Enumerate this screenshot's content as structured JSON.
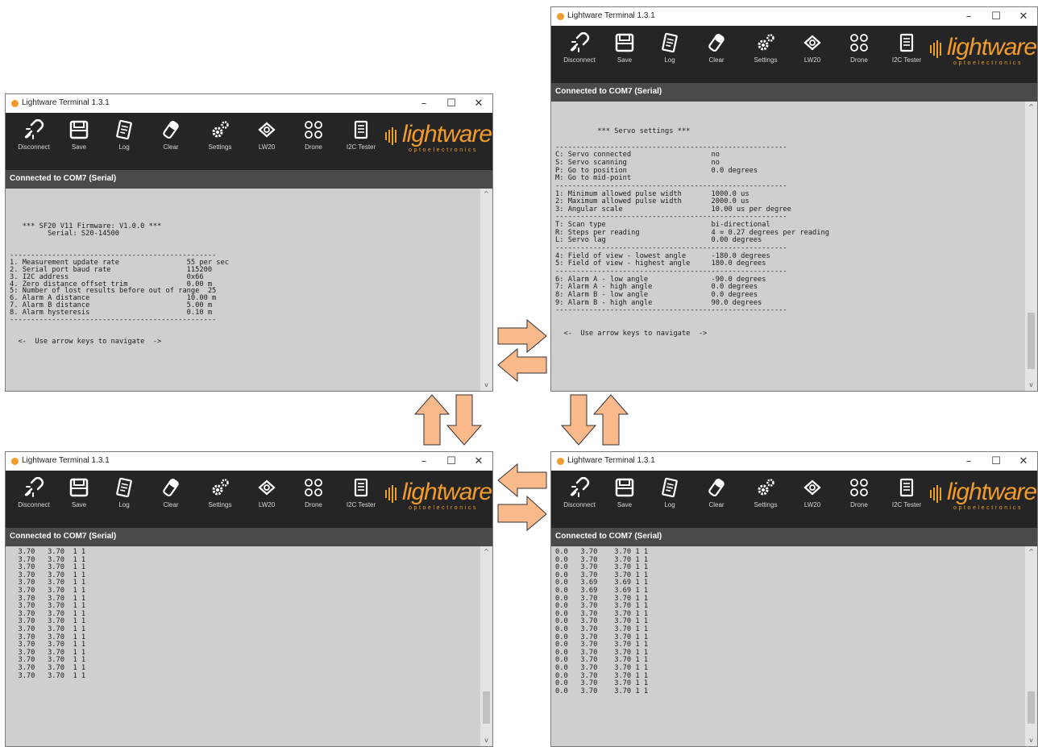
{
  "app_title": "Lightware Terminal 1.3.1",
  "window_controls": {
    "minimize": "–",
    "maximize": "☐",
    "close": "✕"
  },
  "toolbar": [
    {
      "label": "Disconnect",
      "icon": "broken-link-icon"
    },
    {
      "label": "Save",
      "icon": "floppy-disk-icon"
    },
    {
      "label": "Log",
      "icon": "notepad-icon"
    },
    {
      "label": "Clear",
      "icon": "eraser-icon"
    },
    {
      "label": "Settings",
      "icon": "gears-icon"
    },
    {
      "label": "LW20",
      "icon": "sensor-icon"
    },
    {
      "label": "Drone",
      "icon": "drone-icon"
    },
    {
      "label": "I2C Tester",
      "icon": "document-icon"
    }
  ],
  "logo": {
    "word": "lightware",
    "tagline": "optoelectronics"
  },
  "status": "Connected to COM7 (Serial)",
  "scroll": {
    "up": "^",
    "down": "v"
  },
  "colors": {
    "accent": "#f29b2c",
    "toolbar_bg": "#252525",
    "status_bg": "#4a4a4a",
    "terminal_bg": "#cfcfcf",
    "arrow_fill": "#f9b98a"
  },
  "windows": [
    {
      "id": "main-settings",
      "lines": [
        "",
        "",
        "   *** SF20 V11 Firmware: V1.0.0 ***",
        "         Serial: S20-14500",
        "",
        "",
        "-------------------------------------------------",
        "1. Measurement update rate                55 per sec",
        "2. Serial port baud rate                  115200",
        "3. I2C address                            0x66",
        "4. Zero distance offset trim              0.00 m",
        "5: Number of lost results before out of range  25",
        "6. Alarm A distance                       10.00 m",
        "7. Alarm B distance                       5.00 m",
        "8. Alarm hysteresis                       0.10 m",
        "-------------------------------------------------",
        "",
        "",
        "  <-  Use arrow keys to navigate  ->"
      ]
    },
    {
      "id": "servo-settings",
      "lines": [
        "",
        "",
        "          *** Servo settings ***",
        "",
        "-------------------------------------------------------",
        "C: Servo connected                   no",
        "S: Servo scanning                    no",
        "P: Go to position                    0.0 degrees",
        "M: Go to mid-point",
        "-------------------------------------------------------",
        "1: Minimum allowed pulse width       1000.0 us",
        "2: Maximum allowed pulse width       2000.0 us",
        "3: Angular scale                     10.00 us per degree",
        "-------------------------------------------------------",
        "T: Scan type                         bi-directional",
        "R: Steps per reading                 4 = 0.27 degrees per reading",
        "L: Servo lag                         0.00 degrees",
        "-------------------------------------------------------",
        "4: Field of view - lowest angle      -180.0 degrees",
        "5: Field of view - highest angle     180.0 degrees",
        "-------------------------------------------------------",
        "6: Alarm A - low angle               -90.0 degrees",
        "7: Alarm A - high angle              0.0 degrees",
        "8: Alarm B - low angle               0.0 degrees",
        "9: Alarm B - high angle              90.0 degrees",
        "-------------------------------------------------------",
        "",
        "",
        "  <-  Use arrow keys to navigate  ->"
      ]
    },
    {
      "id": "distance-stream",
      "lines": [
        "  3.70   3.70  1 1",
        "  3.70   3.70  1 1",
        "  3.70   3.70  1 1",
        "  3.70   3.70  1 1",
        "  3.70   3.70  1 1",
        "  3.70   3.70  1 1",
        "  3.70   3.70  1 1",
        "  3.70   3.70  1 1",
        "  3.70   3.70  1 1",
        "  3.70   3.70  1 1",
        "  3.70   3.70  1 1",
        "  3.70   3.70  1 1",
        "  3.70   3.70  1 1",
        "  3.70   3.70  1 1",
        "  3.70   3.70  1 1",
        "  3.70   3.70  1 1",
        "  3.70   3.70  1 1"
      ]
    },
    {
      "id": "angle-distance-stream",
      "lines": [
        "0.0   3.70    3.70 1 1",
        "0.0   3.70    3.70 1 1",
        "0.0   3.70    3.70 1 1",
        "0.0   3.70    3.70 1 1",
        "0.0   3.69    3.69 1 1",
        "0.0   3.69    3.69 1 1",
        "0.0   3.70    3.70 1 1",
        "0.0   3.70    3.70 1 1",
        "0.0   3.70    3.70 1 1",
        "0.0   3.70    3.70 1 1",
        "0.0   3.70    3.70 1 1",
        "0.0   3.70    3.70 1 1",
        "0.0   3.70    3.70 1 1",
        "0.0   3.70    3.70 1 1",
        "0.0   3.70    3.70 1 1",
        "0.0   3.70    3.70 1 1",
        "0.0   3.70    3.70 1 1",
        "0.0   3.70    3.70 1 1",
        "0.0   3.70    3.70 1 1"
      ]
    }
  ]
}
